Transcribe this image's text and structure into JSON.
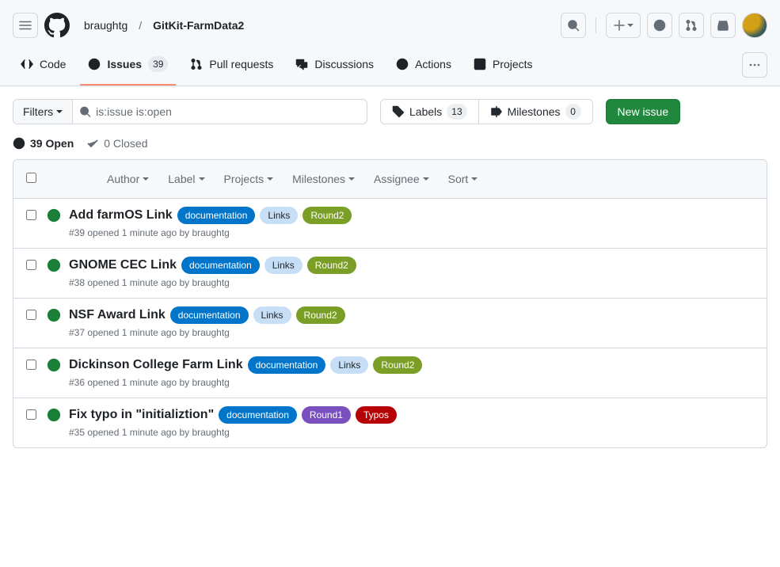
{
  "header": {
    "owner": "braughtg",
    "repo": "GitKit-FarmData2"
  },
  "nav": {
    "code": "Code",
    "issues": "Issues",
    "issues_count": "39",
    "pulls": "Pull requests",
    "discussions": "Discussions",
    "actions": "Actions",
    "projects": "Projects"
  },
  "toolbar": {
    "filters_label": "Filters",
    "search_value": "is:issue is:open",
    "labels_label": "Labels",
    "labels_count": "13",
    "milestones_label": "Milestones",
    "milestones_count": "0",
    "new_issue": "New issue"
  },
  "states": {
    "open": "39 Open",
    "closed": "0 Closed"
  },
  "list_filters": {
    "author": "Author",
    "label": "Label",
    "projects": "Projects",
    "milestones": "Milestones",
    "assignee": "Assignee",
    "sort": "Sort"
  },
  "label_colors": {
    "documentation": {
      "bg": "#0075ca",
      "fg": "#ffffff"
    },
    "Links": {
      "bg": "#C7DEF7",
      "fg": "#1f2328"
    },
    "Round2": {
      "bg": "#7a9e26",
      "fg": "#ffffff"
    },
    "Round1": {
      "bg": "#7a4fbf",
      "fg": "#ffffff"
    },
    "Typos": {
      "bg": "#b60205",
      "fg": "#ffffff"
    }
  },
  "issues": [
    {
      "title": "Add farmOS Link",
      "number": "39",
      "opened": "1 minute ago",
      "author": "braughtg",
      "labels": [
        "documentation",
        "Links",
        "Round2"
      ]
    },
    {
      "title": "GNOME CEC Link",
      "number": "38",
      "opened": "1 minute ago",
      "author": "braughtg",
      "labels": [
        "documentation",
        "Links",
        "Round2"
      ]
    },
    {
      "title": "NSF Award Link",
      "number": "37",
      "opened": "1 minute ago",
      "author": "braughtg",
      "labels": [
        "documentation",
        "Links",
        "Round2"
      ]
    },
    {
      "title": "Dickinson College Farm Link",
      "number": "36",
      "opened": "1 minute ago",
      "author": "braughtg",
      "labels": [
        "documentation",
        "Links",
        "Round2"
      ]
    },
    {
      "title": "Fix typo in \"initializtion\"",
      "number": "35",
      "opened": "1 minute ago",
      "author": "braughtg",
      "labels": [
        "documentation",
        "Round1",
        "Typos"
      ]
    }
  ]
}
